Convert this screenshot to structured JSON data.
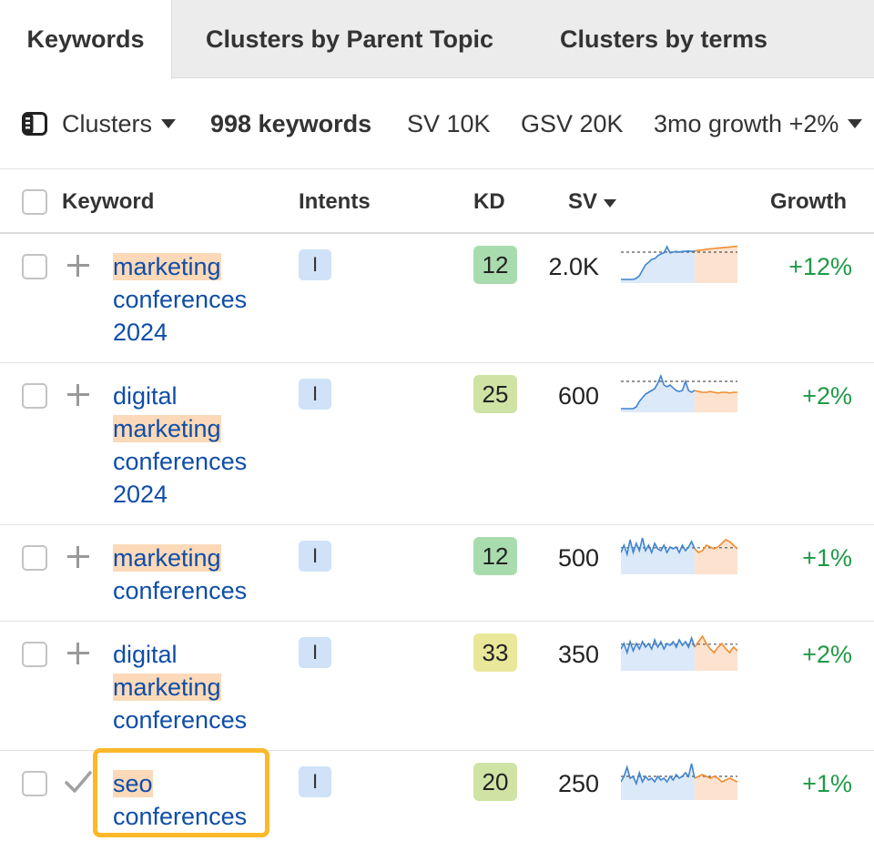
{
  "tabs": [
    {
      "label": "Keywords",
      "active": true
    },
    {
      "label": "Clusters by Parent Topic",
      "active": false
    },
    {
      "label": "Clusters by terms",
      "active": false
    }
  ],
  "toolbar": {
    "clusters_icon": "sidebar-panel-icon",
    "clusters_label": "Clusters",
    "keywords_count": "998 keywords",
    "sv": "SV 10K",
    "gsv": "GSV 20K",
    "growth": "3mo growth +2%"
  },
  "columns": {
    "keyword": "Keyword",
    "intents": "Intents",
    "kd": "KD",
    "sv": "SV",
    "growth": "Growth"
  },
  "colors": {
    "kd_green": "#a8dcae",
    "kd_lightgreen": "#cfe3a4",
    "kd_yellow": "#e9e79a",
    "highlight": "#fcd9b8",
    "link": "#0f4da8",
    "growth": "#1e9a46",
    "focus": "#fbb829"
  },
  "rows": [
    {
      "lines": [
        "marketing",
        "conferences",
        "2024"
      ],
      "highlight_line": 0,
      "intent": "I",
      "kd": "12",
      "kd_color": "#a8dcae",
      "sv": "2.0K",
      "growth": "+12%",
      "action_icon": "plus-icon",
      "trend": {
        "history": [
          0.05,
          0.05,
          0.05,
          0.05,
          0.05,
          0.08,
          0.15,
          0.3,
          0.45,
          0.52,
          0.6,
          0.62,
          0.7,
          0.75,
          0.78,
          0.95,
          0.78,
          0.8,
          0.82,
          0.8,
          0.82,
          0.82,
          0.83,
          0.82,
          0.83
        ],
        "forecast": [
          0.83,
          0.85,
          0.86,
          0.88,
          0.89,
          0.9,
          0.91,
          0.92,
          0.93,
          0.94,
          0.95,
          0.96
        ],
        "baseline": 0.8
      }
    },
    {
      "lines": [
        "digital",
        "marketing",
        "conferences",
        "2024"
      ],
      "highlight_line": 1,
      "intent": "I",
      "kd": "25",
      "kd_color": "#cfe3a4",
      "sv": "600",
      "growth": "+2%",
      "action_icon": "plus-icon",
      "trend": {
        "history": [
          0.05,
          0.05,
          0.05,
          0.05,
          0.05,
          0.1,
          0.25,
          0.35,
          0.45,
          0.5,
          0.55,
          0.6,
          0.75,
          0.95,
          0.7,
          0.65,
          0.7,
          0.62,
          0.55,
          0.52,
          0.55,
          0.8,
          0.55,
          0.5,
          0.55
        ],
        "forecast": [
          0.55,
          0.52,
          0.5,
          0.5,
          0.52,
          0.5,
          0.48,
          0.5,
          0.5,
          0.48,
          0.5,
          0.5
        ],
        "baseline": 0.8
      }
    },
    {
      "lines": [
        "marketing",
        "conferences"
      ],
      "highlight_line": 0,
      "intent": "I",
      "kd": "12",
      "kd_color": "#a8dcae",
      "sv": "500",
      "growth": "+1%",
      "action_icon": "plus-icon",
      "trend": {
        "history": [
          0.55,
          0.75,
          0.5,
          0.9,
          0.55,
          0.8,
          0.6,
          0.95,
          0.6,
          0.75,
          0.55,
          0.8,
          0.65,
          0.6,
          0.75,
          0.55,
          0.7,
          0.65,
          0.7,
          0.55,
          0.75,
          0.6,
          0.7,
          0.85,
          0.65
        ],
        "forecast": [
          0.65,
          0.55,
          0.6,
          0.75,
          0.7,
          0.65,
          0.7,
          0.8,
          0.9,
          0.85,
          0.75,
          0.65
        ],
        "baseline": 0.68
      }
    },
    {
      "lines": [
        "digital",
        "marketing",
        "conferences"
      ],
      "highlight_line": 1,
      "intent": "I",
      "kd": "33",
      "kd_color": "#e9e79a",
      "sv": "350",
      "growth": "+2%",
      "action_icon": "plus-icon",
      "trend": {
        "history": [
          0.55,
          0.7,
          0.45,
          0.75,
          0.5,
          0.7,
          0.55,
          0.75,
          0.6,
          0.7,
          0.55,
          0.8,
          0.6,
          0.75,
          0.55,
          0.7,
          0.65,
          0.75,
          0.6,
          0.8,
          0.65,
          0.75,
          0.6,
          0.85,
          0.6
        ],
        "forecast": [
          0.6,
          0.75,
          0.9,
          0.7,
          0.55,
          0.45,
          0.6,
          0.7,
          0.55,
          0.45,
          0.6,
          0.5
        ],
        "baseline": 0.68
      }
    },
    {
      "lines": [
        "seo",
        "conferences"
      ],
      "highlight_line": 0,
      "intent": "I",
      "kd": "20",
      "kd_color": "#cfe3a4",
      "sv": "250",
      "growth": "+1%",
      "action_icon": "checkmark-icon",
      "trend": {
        "history": [
          0.45,
          0.6,
          0.85,
          0.55,
          0.6,
          0.4,
          0.7,
          0.45,
          0.6,
          0.5,
          0.55,
          0.45,
          0.6,
          0.5,
          0.55,
          0.45,
          0.6,
          0.5,
          0.65,
          0.55,
          0.6,
          0.7,
          0.6,
          0.95,
          0.55
        ],
        "forecast": [
          0.55,
          0.6,
          0.65,
          0.6,
          0.55,
          0.6,
          0.55,
          0.45,
          0.5,
          0.55,
          0.5,
          0.45
        ],
        "baseline": 0.6
      }
    }
  ]
}
